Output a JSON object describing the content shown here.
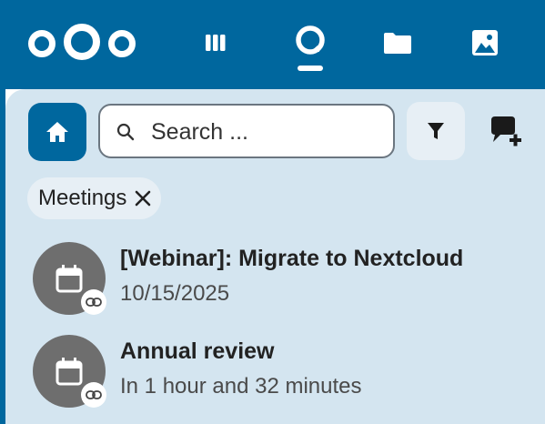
{
  "header": {
    "logo_icon": "nextcloud-logo",
    "nav": [
      {
        "icon": "deck-icon"
      },
      {
        "icon": "talk-icon",
        "active": true
      },
      {
        "icon": "folder-icon"
      },
      {
        "icon": "photos-icon"
      }
    ]
  },
  "toolbar": {
    "home_icon": "home-icon",
    "search_placeholder": "Search ...",
    "search_value": "",
    "filter_icon": "filter-icon",
    "new_conversation_icon": "new-conversation-icon"
  },
  "active_filter": {
    "label": "Meetings"
  },
  "conversations": [
    {
      "title": "[Webinar]: Migrate to Nextcloud",
      "subtitle": "10/15/2025",
      "avatar_icon": "calendar-icon",
      "badge_icon": "link-icon"
    },
    {
      "title": "Annual review",
      "subtitle": "In 1 hour and 32 minutes",
      "avatar_icon": "calendar-icon",
      "badge_icon": "link-icon"
    }
  ],
  "colors": {
    "brand": "#00679e",
    "panel_background": "#d4e5f0",
    "chip_background": "#e7eff5",
    "avatar_background": "#6e6e6e"
  }
}
